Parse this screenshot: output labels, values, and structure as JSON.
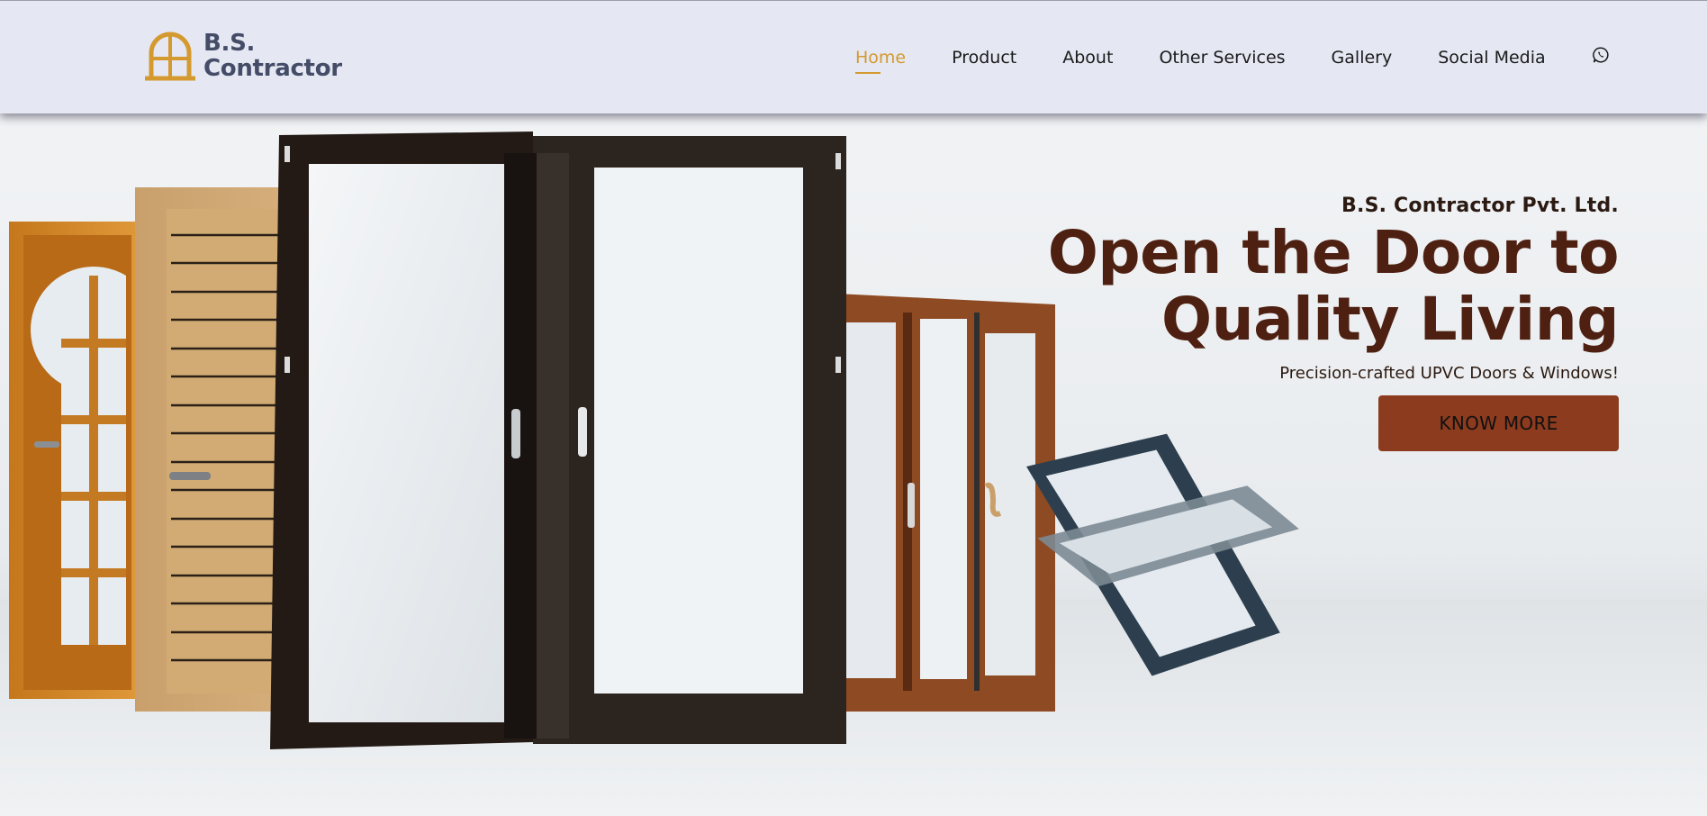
{
  "brand": {
    "line1": "B.S.",
    "line2": "Contractor",
    "logo_icon": "arched-window-icon",
    "logo_color": "#d49a2f",
    "text_color": "#444c68"
  },
  "nav": {
    "items": [
      {
        "label": "Home",
        "active": true
      },
      {
        "label": "Product"
      },
      {
        "label": "About"
      },
      {
        "label": "Other Services"
      },
      {
        "label": "Gallery"
      },
      {
        "label": "Social Media"
      }
    ],
    "whatsapp_icon": "whatsapp-icon",
    "active_color": "#d49a2f"
  },
  "hero": {
    "company": "B.S. Contractor Pvt. Ltd.",
    "headline_line1": "Open the Door to",
    "headline_line2": "Quality Living",
    "tagline": "Precision-crafted UPVC Doors & Windows!",
    "cta_label": "KNOW MORE",
    "headline_color": "#4e2011",
    "cta_color": "#8c3b1f"
  }
}
